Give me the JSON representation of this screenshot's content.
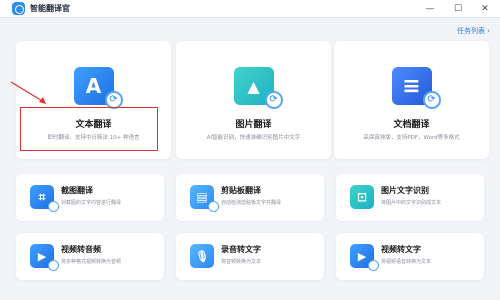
{
  "window": {
    "title": "智能翻译官",
    "minimize_symbol": "—",
    "maximize_symbol": "☐",
    "close_symbol": "✕"
  },
  "header": {
    "task_list_label": "任务列表 ›"
  },
  "main_features": [
    {
      "id": "text",
      "title": "文本翻译",
      "subtitle": "即时翻译、支持中日韩法 10+ 种语言",
      "icon": "text-translate-icon",
      "glyph": "A"
    },
    {
      "id": "image",
      "title": "图片翻译",
      "subtitle": "AI智能识别，快速准确识别图片中文字",
      "icon": "image-translate-icon",
      "glyph": "▲"
    },
    {
      "id": "doc",
      "title": "文档翻译",
      "subtitle": "高保真排版，支持PDF，Word等多格式",
      "icon": "document-translate-icon",
      "glyph": "≡"
    }
  ],
  "secondary_features": [
    {
      "id": "screenshot",
      "title": "截图翻译",
      "subtitle": "对截图的文字内容进行翻译",
      "icon": "screenshot-translate-icon",
      "glyph": "⌗"
    },
    {
      "id": "clipboard",
      "title": "剪贴板翻译",
      "subtitle": "自动检测剪贴板文字并翻译",
      "icon": "clipboard-translate-icon",
      "glyph": "▤"
    },
    {
      "id": "ocr",
      "title": "图片文字识别",
      "subtitle": "将图片中的文字识别成文本",
      "icon": "image-ocr-icon",
      "glyph": "⊡"
    },
    {
      "id": "video-audio",
      "title": "视频转音频",
      "subtitle": "将多种格式视频转换为音频",
      "icon": "video-to-audio-icon",
      "glyph": "▶"
    },
    {
      "id": "record-text",
      "title": "录音转文字",
      "subtitle": "将音频转换为文本",
      "icon": "audio-to-text-icon",
      "glyph": "🎙"
    },
    {
      "id": "video-text",
      "title": "视频转文字",
      "subtitle": "将视频语音转换为文本",
      "icon": "video-to-text-icon",
      "glyph": "▶"
    }
  ],
  "colors": {
    "accent": "#2c7be5",
    "highlight": "#e03434",
    "background": "#f2f4f8"
  }
}
